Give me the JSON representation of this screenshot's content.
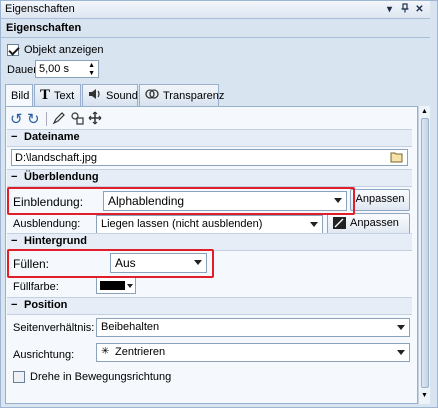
{
  "window": {
    "title": "Eigenschaften"
  },
  "section": {
    "title": "Eigenschaften"
  },
  "object": {
    "show_label": "Objekt anzeigen",
    "checked": true
  },
  "duration": {
    "label": "Dauer:",
    "value": "5,00 s"
  },
  "tabs": [
    {
      "label": "Bild",
      "icon": "image-icon"
    },
    {
      "label": "Text",
      "icon": "text-icon"
    },
    {
      "label": "Sound",
      "icon": "speaker-icon"
    },
    {
      "label": "Transparenz",
      "icon": "transparency-icon"
    }
  ],
  "groups": {
    "file": "Dateiname",
    "blend": "Überblendung",
    "background": "Hintergrund",
    "position": "Position"
  },
  "file": {
    "value": "D:\\landschaft.jpg"
  },
  "blend": {
    "in_label": "Einblendung:",
    "in_value": "Alphablending",
    "out_label": "Ausblendung:",
    "out_value": "Liegen lassen (nicht ausblenden)",
    "adjust_label": "Anpassen"
  },
  "background": {
    "fill_label": "Füllen:",
    "fill_value": "Aus",
    "color_label": "Füllfarbe:",
    "color_value": "#000000"
  },
  "position": {
    "aspect_label": "Seitenverhältnis:",
    "aspect_value": "Beibehalten",
    "align_label": "Ausrichtung:",
    "align_value": "Zentrieren",
    "rotate_label": "Drehe in Bewegungsrichtung"
  },
  "colors": {
    "highlight": "#e01f2b",
    "panel": "#d9e4f1"
  }
}
